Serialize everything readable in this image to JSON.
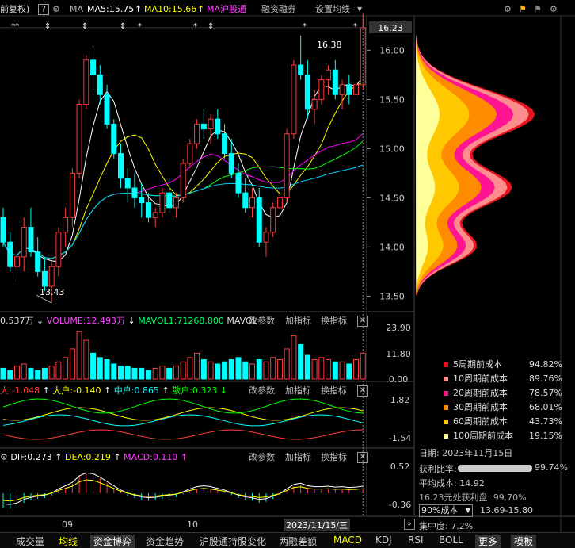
{
  "header": {
    "title": "前复权)",
    "help": "?",
    "ma_label": "MA",
    "ma5": "MA5:15.75",
    "ma10": "MA10:15.66",
    "ma_sh": "MA沪股通",
    "btn_margin": "融资融券",
    "btn_settings": "设置均线"
  },
  "markers": [
    "**",
    "⇕",
    "⇕",
    "⇕",
    "*",
    "*",
    "⇕",
    "*",
    "*"
  ],
  "price_axis": {
    "ticks": [
      "16.00",
      "15.50",
      "15.00",
      "14.50",
      "14.00",
      "13.50"
    ],
    "current": "16.23"
  },
  "annotations": {
    "high": "16.38",
    "low": "13.43"
  },
  "volume": {
    "vol_prefix": "0.537万",
    "volume_label": "VOLUME:12.493万",
    "mavol1": "MAVOL1:71268.800",
    "mavol2": "MAVOL",
    "ticks": [
      "23.90",
      "11.80",
      "0.00"
    ]
  },
  "capital": {
    "super": "大:-1.048",
    "big": "大户:-0.140",
    "mid": "中户:0.865",
    "retail": "散户:0.323",
    "ticks": [
      "1.82",
      "-1.54"
    ]
  },
  "macd": {
    "dif": "DIF:0.273",
    "dea": "DEA:0.219",
    "macd": "MACD:0.110",
    "ticks": [
      "0.52",
      "-0.36"
    ]
  },
  "panel_buttons": {
    "params": "改参数",
    "add": "加指标",
    "switch": "换指标",
    "close": "✕"
  },
  "x_axis": {
    "m09": "09",
    "m10": "10",
    "cursor_date": "2023/11/15/三"
  },
  "cost_legend": [
    {
      "label": "5周期前成本",
      "value": "94.82%",
      "color": "#e8141e"
    },
    {
      "label": "10周期前成本",
      "value": "89.76%",
      "color": "#ff8c8c"
    },
    {
      "label": "20周期前成本",
      "value": "78.57%",
      "color": "#ff1493"
    },
    {
      "label": "30周期前成本",
      "value": "68.01%",
      "color": "#ff8c00"
    },
    {
      "label": "60周期前成本",
      "value": "43.73%",
      "color": "#ffc800"
    },
    {
      "label": "100周期前成本",
      "value": "19.15%",
      "color": "#ffff99"
    }
  ],
  "cost_info": {
    "date": "日期: 2023年11月15日",
    "profit_label": "获利比率:",
    "profit_value": "99.74%",
    "avg_cost": "平均成本: 14.92",
    "profit_at": "16.23元处获利盘: 99.70%",
    "cost_select": "90%成本",
    "cost_range": "13.69-15.80",
    "concentration": "集中度: 7.2%"
  },
  "tabs": [
    "成交量",
    "均线",
    "资金博弈",
    "资金趋势",
    "沪股通持股变化",
    "两融差额",
    "MACD",
    "KDJ",
    "RSI",
    "BOLL",
    "更多",
    "模板"
  ],
  "colors": {
    "up": "#ff3c3c",
    "down": "#00ffff",
    "ma5": "#ffffff",
    "ma10": "#ffff00",
    "ma20": "#ff00ff",
    "ma30": "#00ff00"
  },
  "chart_data": {
    "type": "candlestick",
    "ylim": [
      13.35,
      16.35
    ],
    "candles": [
      [
        14.3,
        14.4,
        14.0,
        14.05
      ],
      [
        14.05,
        14.15,
        13.75,
        13.8
      ],
      [
        13.8,
        14.0,
        13.65,
        13.9
      ],
      [
        13.9,
        14.3,
        13.75,
        14.2
      ],
      [
        14.2,
        14.4,
        13.9,
        13.95
      ],
      [
        13.95,
        14.1,
        13.7,
        13.75
      ],
      [
        13.75,
        13.9,
        13.55,
        13.6
      ],
      [
        13.6,
        13.85,
        13.43,
        13.8
      ],
      [
        13.8,
        14.2,
        13.7,
        14.15
      ],
      [
        14.15,
        14.4,
        14.0,
        14.3
      ],
      [
        14.3,
        14.8,
        14.2,
        14.75
      ],
      [
        14.75,
        15.5,
        14.7,
        15.45
      ],
      [
        15.45,
        15.95,
        15.4,
        15.9
      ],
      [
        15.9,
        16.05,
        15.6,
        15.75
      ],
      [
        15.75,
        15.85,
        15.45,
        15.55
      ],
      [
        15.55,
        15.65,
        15.2,
        15.25
      ],
      [
        15.25,
        15.3,
        14.9,
        14.95
      ],
      [
        14.95,
        15.05,
        14.6,
        14.7
      ],
      [
        14.7,
        14.8,
        14.45,
        14.6
      ],
      [
        14.6,
        14.75,
        14.4,
        14.5
      ],
      [
        14.5,
        14.65,
        14.3,
        14.45
      ],
      [
        14.45,
        14.55,
        14.25,
        14.3
      ],
      [
        14.3,
        14.4,
        14.2,
        14.35
      ],
      [
        14.35,
        14.6,
        14.3,
        14.55
      ],
      [
        14.55,
        14.7,
        14.35,
        14.4
      ],
      [
        14.4,
        14.55,
        14.3,
        14.5
      ],
      [
        14.5,
        14.9,
        14.45,
        14.85
      ],
      [
        14.85,
        15.1,
        14.8,
        15.05
      ],
      [
        15.05,
        15.3,
        15.0,
        15.25
      ],
      [
        15.25,
        15.4,
        15.1,
        15.2
      ],
      [
        15.2,
        15.35,
        15.05,
        15.3
      ],
      [
        15.3,
        15.4,
        15.1,
        15.15
      ],
      [
        15.15,
        15.25,
        14.9,
        14.95
      ],
      [
        14.95,
        15.1,
        14.7,
        14.75
      ],
      [
        14.75,
        14.85,
        14.5,
        14.55
      ],
      [
        14.55,
        14.7,
        14.35,
        14.4
      ],
      [
        14.4,
        14.6,
        14.3,
        14.5
      ],
      [
        14.5,
        14.6,
        14.0,
        14.05
      ],
      [
        14.05,
        14.2,
        13.9,
        14.15
      ],
      [
        14.15,
        14.45,
        14.1,
        14.4
      ],
      [
        14.4,
        14.6,
        14.3,
        14.5
      ],
      [
        14.5,
        15.2,
        14.45,
        15.15
      ],
      [
        15.15,
        15.9,
        15.1,
        15.85
      ],
      [
        15.85,
        16.15,
        15.7,
        15.75
      ],
      [
        15.75,
        15.9,
        15.3,
        15.4
      ],
      [
        15.4,
        15.6,
        15.25,
        15.5
      ],
      [
        15.5,
        15.75,
        15.45,
        15.7
      ],
      [
        15.7,
        15.85,
        15.55,
        15.8
      ],
      [
        15.8,
        15.9,
        15.5,
        15.55
      ],
      [
        15.55,
        15.7,
        15.4,
        15.65
      ],
      [
        15.65,
        15.75,
        15.45,
        15.55
      ],
      [
        15.55,
        15.7,
        15.5,
        15.65
      ],
      [
        15.65,
        16.38,
        15.6,
        16.23
      ]
    ],
    "volumes": [
      5,
      4,
      6,
      7,
      5,
      4,
      5,
      6,
      8,
      10,
      14,
      22,
      18,
      12,
      10,
      9,
      7,
      6,
      6,
      5,
      5,
      4,
      5,
      6,
      5,
      6,
      8,
      10,
      12,
      9,
      8,
      7,
      8,
      9,
      10,
      8,
      7,
      9,
      8,
      10,
      9,
      14,
      20,
      16,
      11,
      9,
      10,
      9,
      8,
      8,
      7,
      9,
      12
    ],
    "macd_hist": [
      -0.3,
      -0.32,
      -0.28,
      -0.2,
      -0.15,
      -0.12,
      -0.1,
      -0.05,
      0.05,
      0.12,
      0.2,
      0.35,
      0.42,
      0.4,
      0.32,
      0.22,
      0.12,
      0.02,
      -0.05,
      -0.1,
      -0.14,
      -0.16,
      -0.15,
      -0.12,
      -0.1,
      -0.08,
      -0.02,
      0.05,
      0.1,
      0.12,
      0.1,
      0.06,
      0.02,
      -0.04,
      -0.1,
      -0.14,
      -0.16,
      -0.2,
      -0.18,
      -0.12,
      -0.06,
      0.05,
      0.15,
      0.18,
      0.12,
      0.1,
      0.1,
      0.11,
      0.09,
      0.1,
      0.08,
      0.09,
      0.11
    ]
  }
}
